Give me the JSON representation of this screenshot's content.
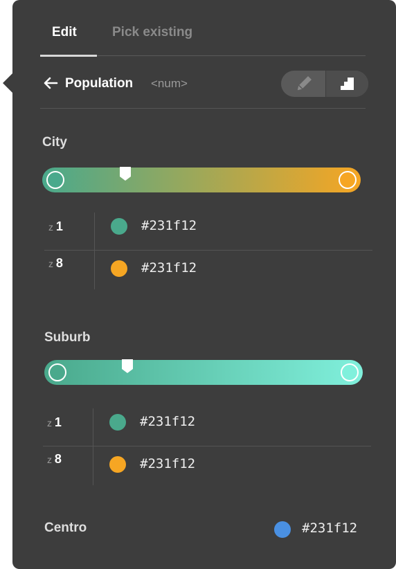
{
  "tabs": {
    "edit": "Edit",
    "pick_existing": "Pick existing",
    "active": "edit"
  },
  "property": {
    "name": "Population",
    "type": "<num>",
    "back_icon": "arrow-left-icon",
    "mode_icons": [
      "pencil-icon",
      "steps-icon"
    ],
    "active_mode": "steps"
  },
  "colors": {
    "panel": "#3d3d3d",
    "teal": "#4aa98c",
    "orange": "#f6a623",
    "aqua": "#80f0dc",
    "blue": "#4a90e2"
  },
  "sections": [
    {
      "title": "City",
      "ramp": {
        "from": "#4aa98c",
        "to": "#f6a623",
        "marker_position": 0.26
      },
      "stops": [
        {
          "zoom_prefix": "z",
          "zoom": "1",
          "color": "#4aa98c",
          "hex": "#231f12"
        },
        {
          "zoom_prefix": "z",
          "zoom": "8",
          "color": "#f6a623",
          "hex": "#231f12"
        }
      ]
    },
    {
      "title": "Suburb",
      "ramp": {
        "from": "#4aa98c",
        "to": "#80f0dc",
        "marker_position": 0.26
      },
      "stops": [
        {
          "zoom_prefix": "z",
          "zoom": "1",
          "color": "#4aa98c",
          "hex": "#231f12"
        },
        {
          "zoom_prefix": "z",
          "zoom": "8",
          "color": "#f6a623",
          "hex": "#231f12"
        }
      ]
    }
  ],
  "centro": {
    "label": "Centro",
    "color": "#4a90e2",
    "hex": "#231f12"
  }
}
